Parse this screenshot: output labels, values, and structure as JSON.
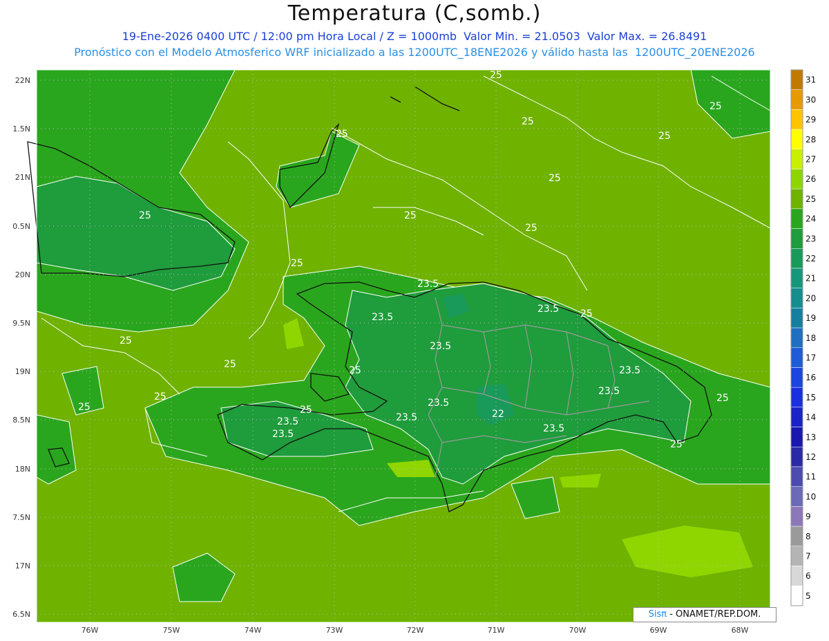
{
  "title": "Temperatura (C,somb.)",
  "subtitle_line1": "19-Ene-2026 0400 UTC / 12:00 pm Hora Local / Z = 1000mb  Valor Min. = 21.0503  Valor Max. = 26.8491",
  "subtitle_line2": "Pronóstico con el Modelo Atmosferico WRF inicializado a las 1200UTC_18ENE2026 y válido hasta las  1200UTC_20ENE2026",
  "credit": {
    "brand": "Sis",
    "pi": "π",
    "text": "- ONAMET/REP.DOM."
  },
  "lat_labels": [
    "22N",
    "1.5N",
    "21N",
    "0.5N",
    "20N",
    "9.5N",
    "19N",
    "8.5N",
    "18N",
    "7.5N",
    "17N",
    "6.5N"
  ],
  "lon_labels": [
    "76W",
    "75W",
    "74W",
    "73W",
    "72W",
    "71W",
    "70W",
    "69W",
    "68W"
  ],
  "contour_labels": [
    "25",
    "25",
    "25",
    "25",
    "25",
    "25",
    "25",
    "25",
    "25",
    "25",
    "25",
    "25",
    "25",
    "25",
    "25",
    "25",
    "25",
    "25",
    "25",
    "23.5",
    "23.5",
    "23.5",
    "23.5",
    "23.5",
    "23.5",
    "23.5",
    "23.5",
    "23.5",
    "23.5",
    "23.5",
    "22"
  ],
  "colorbar": {
    "labels": [
      "31",
      "30",
      "29",
      "28",
      "27",
      "26",
      "25",
      "24",
      "23",
      "22",
      "21",
      "20",
      "19",
      "18",
      "17",
      "16",
      "15",
      "14",
      "13",
      "12",
      "11",
      "10",
      "9",
      "8",
      "7",
      "6",
      "5"
    ],
    "colors": [
      "#c07a00",
      "#e69a00",
      "#ffc400",
      "#ffff00",
      "#c8f000",
      "#8fd600",
      "#6fb200",
      "#2aa61e",
      "#1f9c3c",
      "#199a5a",
      "#17977a",
      "#168e8e",
      "#157fa0",
      "#1f6fc0",
      "#1e5bd8",
      "#1b44e0",
      "#1a2fe0",
      "#1a22c8",
      "#1a17b0",
      "#2a2aa8",
      "#4b4bb0",
      "#6a6ab8",
      "#8a78b8",
      "#9a9a9a",
      "#b4b4b4",
      "#d8d8d8",
      "#ffffff"
    ]
  },
  "colors": {
    "land_sea_base": "#6fb200",
    "zone_24": "#2aa61e",
    "zone_23": "#1f9c3c",
    "zone_22": "#199a5a",
    "zone_26": "#8fd600",
    "title_blue": "#1a3fd6",
    "subtitle_blue": "#2a8fe6"
  }
}
